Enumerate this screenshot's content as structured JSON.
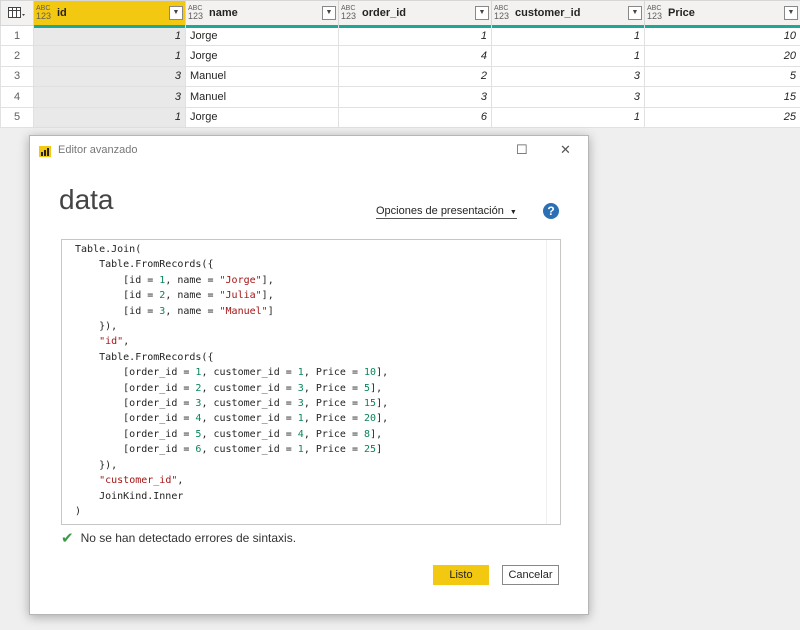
{
  "table": {
    "columns": [
      {
        "type_top": "ABC",
        "type_bottom": "123",
        "name": "id"
      },
      {
        "type_top": "ABC",
        "type_bottom": "123",
        "name": "name"
      },
      {
        "type_top": "ABC",
        "type_bottom": "123",
        "name": "order_id"
      },
      {
        "type_top": "ABC",
        "type_bottom": "123",
        "name": "customer_id"
      },
      {
        "type_top": "ABC",
        "type_bottom": "123",
        "name": "Price"
      }
    ],
    "rows": [
      {
        "n": "1",
        "id": "1",
        "name": "Jorge",
        "order_id": "1",
        "customer_id": "1",
        "price": "10"
      },
      {
        "n": "2",
        "id": "1",
        "name": "Jorge",
        "order_id": "4",
        "customer_id": "1",
        "price": "20"
      },
      {
        "n": "3",
        "id": "3",
        "name": "Manuel",
        "order_id": "2",
        "customer_id": "3",
        "price": "5"
      },
      {
        "n": "4",
        "id": "3",
        "name": "Manuel",
        "order_id": "3",
        "customer_id": "3",
        "price": "15"
      },
      {
        "n": "5",
        "id": "1",
        "name": "Jorge",
        "order_id": "6",
        "customer_id": "1",
        "price": "25"
      }
    ]
  },
  "dialog": {
    "title": "Editor avanzado",
    "query_name": "data",
    "display_options": "Opciones de presentación",
    "help": "?",
    "code": [
      [
        {
          "t": "Table.Join("
        }
      ],
      [
        {
          "t": "    Table.FromRecords({"
        }
      ],
      [
        {
          "t": "        [id = "
        },
        {
          "t": "1",
          "c": "n"
        },
        {
          "t": ", name = "
        },
        {
          "t": "\"Jorge\"",
          "c": "s"
        },
        {
          "t": "],"
        }
      ],
      [
        {
          "t": "        [id = "
        },
        {
          "t": "2",
          "c": "n"
        },
        {
          "t": ", name = "
        },
        {
          "t": "\"Julia\"",
          "c": "s"
        },
        {
          "t": "],"
        }
      ],
      [
        {
          "t": "        [id = "
        },
        {
          "t": "3",
          "c": "n"
        },
        {
          "t": ", name = "
        },
        {
          "t": "\"Manuel\"",
          "c": "s"
        },
        {
          "t": "]"
        }
      ],
      [
        {
          "t": "    }),"
        }
      ],
      [
        {
          "t": "    "
        },
        {
          "t": "\"id\"",
          "c": "s"
        },
        {
          "t": ","
        }
      ],
      [
        {
          "t": "    Table.FromRecords({"
        }
      ],
      [
        {
          "t": "        [order_id = "
        },
        {
          "t": "1",
          "c": "n"
        },
        {
          "t": ", customer_id = "
        },
        {
          "t": "1",
          "c": "n"
        },
        {
          "t": ", Price = "
        },
        {
          "t": "10",
          "c": "n"
        },
        {
          "t": "],"
        }
      ],
      [
        {
          "t": "        [order_id = "
        },
        {
          "t": "2",
          "c": "n"
        },
        {
          "t": ", customer_id = "
        },
        {
          "t": "3",
          "c": "n"
        },
        {
          "t": ", Price = "
        },
        {
          "t": "5",
          "c": "n"
        },
        {
          "t": "],"
        }
      ],
      [
        {
          "t": "        [order_id = "
        },
        {
          "t": "3",
          "c": "n"
        },
        {
          "t": ", customer_id = "
        },
        {
          "t": "3",
          "c": "n"
        },
        {
          "t": ", Price = "
        },
        {
          "t": "15",
          "c": "n"
        },
        {
          "t": "],"
        }
      ],
      [
        {
          "t": "        [order_id = "
        },
        {
          "t": "4",
          "c": "n"
        },
        {
          "t": ", customer_id = "
        },
        {
          "t": "1",
          "c": "n"
        },
        {
          "t": ", Price = "
        },
        {
          "t": "20",
          "c": "n"
        },
        {
          "t": "],"
        }
      ],
      [
        {
          "t": "        [order_id = "
        },
        {
          "t": "5",
          "c": "n"
        },
        {
          "t": ", customer_id = "
        },
        {
          "t": "4",
          "c": "n"
        },
        {
          "t": ", Price = "
        },
        {
          "t": "8",
          "c": "n"
        },
        {
          "t": "],"
        }
      ],
      [
        {
          "t": "        [order_id = "
        },
        {
          "t": "6",
          "c": "n"
        },
        {
          "t": ", customer_id = "
        },
        {
          "t": "1",
          "c": "n"
        },
        {
          "t": ", Price = "
        },
        {
          "t": "25",
          "c": "n"
        },
        {
          "t": "]"
        }
      ],
      [
        {
          "t": "    }),"
        }
      ],
      [
        {
          "t": "    "
        },
        {
          "t": "\"customer_id\"",
          "c": "s"
        },
        {
          "t": ","
        }
      ],
      [
        {
          "t": "    JoinKind.Inner"
        }
      ],
      [
        {
          "t": ")"
        }
      ]
    ],
    "status": "No se han detectado errores de sintaxis.",
    "ok_label": "Listo",
    "cancel_label": "Cancelar"
  },
  "colors": {
    "accent": "#f2c811",
    "quality_bar": "#1fa694",
    "string": "#a31515",
    "number": "#098658"
  }
}
